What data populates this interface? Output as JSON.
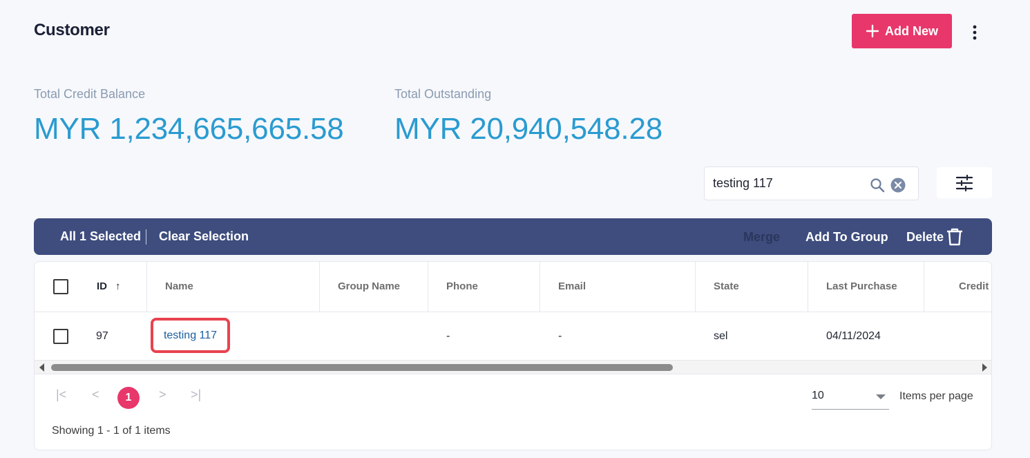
{
  "header": {
    "title": "Customer",
    "add_new_label": "Add New",
    "more_icon": "more-vertical-icon"
  },
  "stats": {
    "credit_balance_label": "Total Credit Balance",
    "credit_balance_value": "MYR 1,234,665,665.58",
    "outstanding_label": "Total Outstanding",
    "outstanding_value": "MYR 20,940,548.28"
  },
  "search": {
    "value": "testing 117",
    "icon": "search-icon",
    "clear_icon": "clear-circle-icon",
    "filter_icon": "sliders-icon"
  },
  "selection_bar": {
    "selected_label": "All 1 Selected",
    "clear_label": "Clear Selection",
    "merge_label": "Merge",
    "add_to_group_label": "Add To Group",
    "delete_label": "Delete"
  },
  "table": {
    "columns": [
      "ID",
      "Name",
      "Group Name",
      "Phone",
      "Email",
      "State",
      "Last Purchase",
      "Credit L"
    ],
    "sort_indicator": "↑",
    "rows": [
      {
        "id": "97",
        "name": "testing 117",
        "group_name": "",
        "phone": "-",
        "email": "-",
        "state": "sel",
        "last_purchase": "04/11/2024",
        "credit": ""
      }
    ]
  },
  "pagination": {
    "first": "|<",
    "prev": "<",
    "current_page": "1",
    "next": ">",
    "last": ">|",
    "per_page_value": "10",
    "per_page_label": "Items per page",
    "showing_text": "Showing 1 - 1 of 1 items"
  },
  "colors": {
    "accent": "#e8376b",
    "stat_value": "#2a9bd0",
    "selection_bar": "#3e4d7e",
    "highlight_border": "#e8434f",
    "link": "#1a5e9e"
  }
}
